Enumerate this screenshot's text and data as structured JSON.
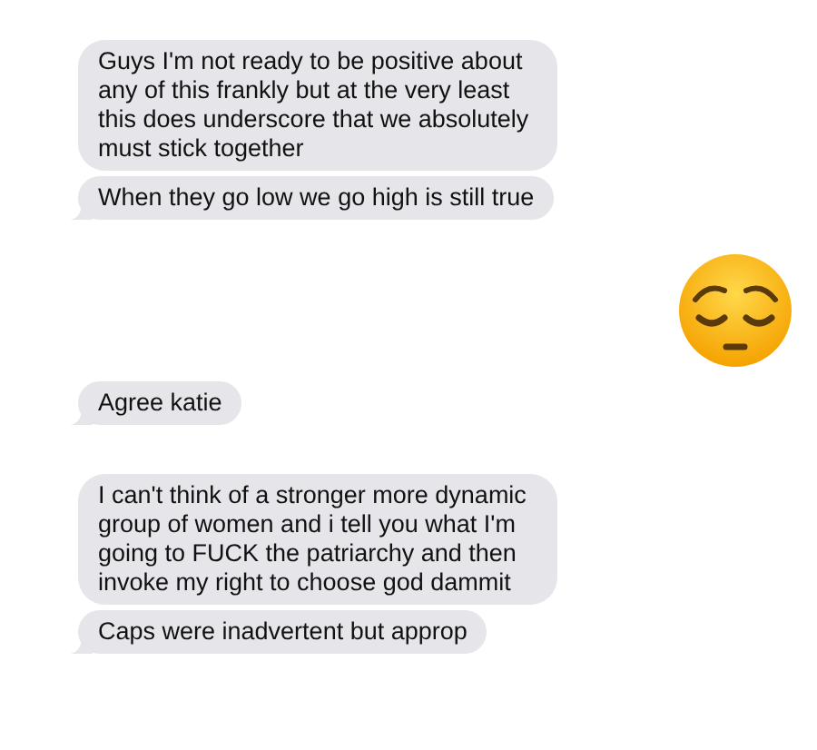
{
  "messages": [
    {
      "kind": "text",
      "text": "Guys I'm not ready to be positive about any of this frankly but at the very least this does underscore that we absolutely must stick together",
      "tail": false
    },
    {
      "kind": "text",
      "text": "When they go low we go high is still true",
      "tail": true
    },
    {
      "kind": "emoji"
    },
    {
      "kind": "text",
      "text": "Agree katie",
      "tail": true
    },
    {
      "kind": "text",
      "text": "I can't think of a stronger more dynamic group of women and i tell you what I'm going to FUCK the patriarchy and then invoke my right to choose god dammit",
      "tail": false
    },
    {
      "kind": "text",
      "text": "Caps were inadvertent but approp",
      "tail": true
    }
  ]
}
